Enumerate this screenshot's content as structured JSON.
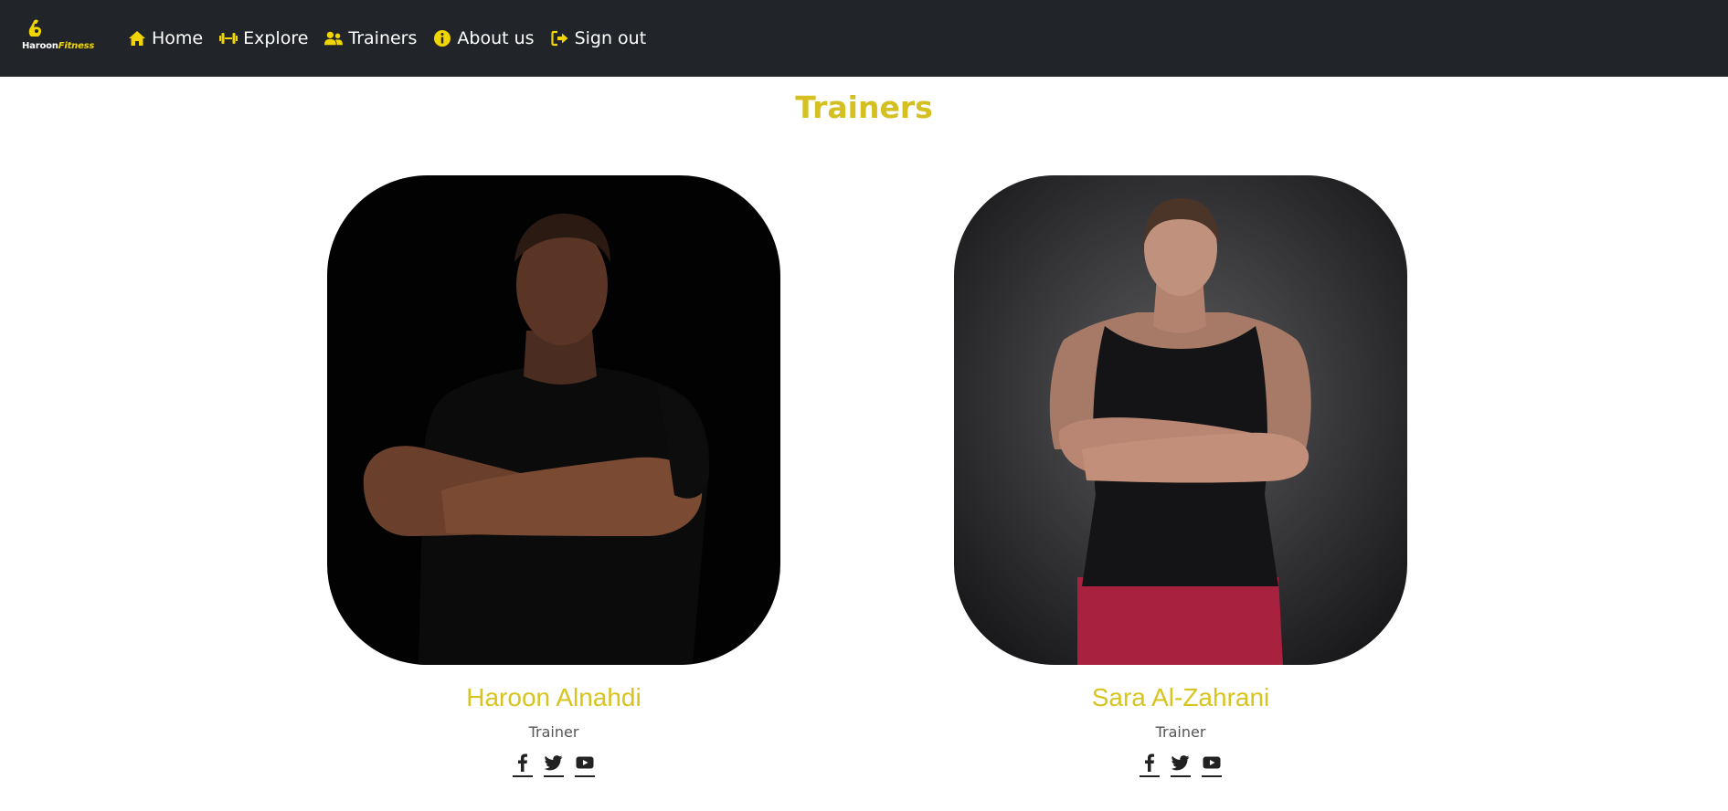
{
  "brand": {
    "name_part1": "Haroon",
    "name_part2": "Fitness"
  },
  "nav": {
    "items": [
      {
        "label": "Home",
        "icon": "home-icon"
      },
      {
        "label": "Explore",
        "icon": "dumbbell-icon"
      },
      {
        "label": "Trainers",
        "icon": "users-icon"
      },
      {
        "label": "About us",
        "icon": "info-circle-icon"
      },
      {
        "label": "Sign out",
        "icon": "sign-out-icon"
      }
    ]
  },
  "page": {
    "title": "Trainers"
  },
  "trainers": [
    {
      "name": "Haroon Alnahdi",
      "role": "Trainer",
      "socials": [
        "facebook-icon",
        "twitter-icon",
        "youtube-icon"
      ]
    },
    {
      "name": "Sara Al-Zahrani",
      "role": "Trainer",
      "socials": [
        "facebook-icon",
        "twitter-icon",
        "youtube-icon"
      ]
    }
  ],
  "colors": {
    "navbar_bg": "#212529",
    "accent": "#d7c41f",
    "icon_yellow": "#f1d500"
  }
}
